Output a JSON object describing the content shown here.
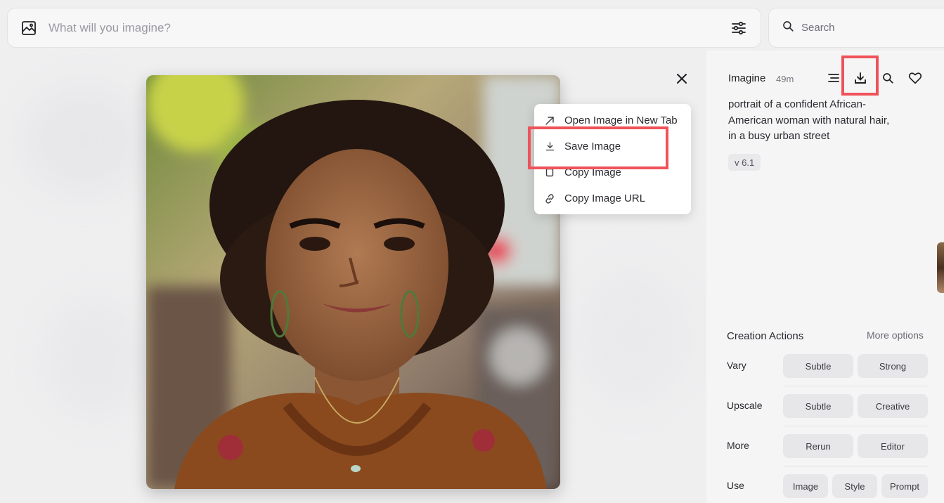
{
  "prompt_bar": {
    "placeholder": "What will you imagine?",
    "icons": [
      "image-icon",
      "sliders-icon"
    ]
  },
  "search_bar": {
    "placeholder": "Search",
    "icon": "search-icon"
  },
  "context_menu": {
    "items": [
      {
        "label": "Open Image in New Tab",
        "icon": "arrow-up-right-icon"
      },
      {
        "label": "Save Image",
        "icon": "download-icon"
      },
      {
        "label": "Copy Image",
        "icon": "copy-icon"
      },
      {
        "label": "Copy Image URL",
        "icon": "link-icon"
      }
    ]
  },
  "panel": {
    "title": "Imagine",
    "time": "49m",
    "toolbar_icons": [
      "menu-lines-icon",
      "download-icon",
      "search-icon",
      "heart-icon"
    ],
    "prompt": "portrait of a confident African-American woman with natural hair, in a busy urban street",
    "version": "v 6.1",
    "section_title": "Creation Actions",
    "more_options": "More options",
    "rows": [
      {
        "label": "Vary",
        "buttons": [
          "Subtle",
          "Strong"
        ]
      },
      {
        "label": "Upscale",
        "buttons": [
          "Subtle",
          "Creative"
        ]
      },
      {
        "label": "More",
        "buttons": [
          "Rerun",
          "Editor"
        ]
      },
      {
        "label": "Use",
        "buttons": [
          "Image",
          "Style",
          "Prompt"
        ]
      }
    ]
  },
  "colors": {
    "highlight": "#f0525a",
    "panel_bg": "#f5f5f6",
    "button_bg": "#e7e7ea"
  }
}
